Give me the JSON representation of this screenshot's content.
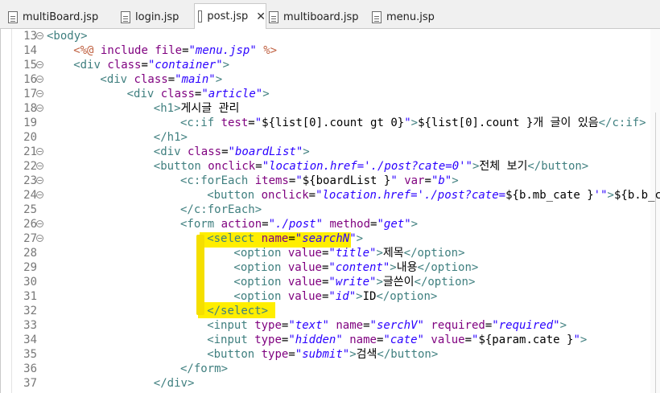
{
  "tabs": [
    {
      "label": "multiBoard.jsp",
      "active": false
    },
    {
      "label": "login.jsp",
      "active": false
    },
    {
      "label": "post.jsp",
      "active": true
    },
    {
      "label": "multiboard.jsp",
      "active": false
    },
    {
      "label": "menu.jsp",
      "active": false
    }
  ],
  "close_glyph": "✕",
  "fold_glyph": "−",
  "highlight_color": "#ffee00",
  "lines": [
    {
      "n": "13",
      "fold": true,
      "indent": 0,
      "parts": [
        [
          "t-tag",
          "<body>"
        ]
      ]
    },
    {
      "n": "14",
      "fold": false,
      "indent": 8,
      "parts": [
        [
          "t-dir",
          "<%@ "
        ],
        [
          "t-dirattr",
          "include "
        ],
        [
          "t-dirattr",
          "file"
        ],
        [
          "t-text",
          "="
        ],
        [
          "t-str",
          "\"menu.jsp\""
        ],
        [
          "t-dir",
          " %>"
        ]
      ]
    },
    {
      "n": "15",
      "fold": true,
      "indent": 8,
      "parts": [
        [
          "t-tag",
          "<div "
        ],
        [
          "t-attr",
          "class"
        ],
        [
          "t-text",
          "="
        ],
        [
          "t-str",
          "\"container\""
        ],
        [
          "t-tag",
          ">"
        ]
      ]
    },
    {
      "n": "16",
      "fold": true,
      "indent": 16,
      "parts": [
        [
          "t-tag",
          "<div "
        ],
        [
          "t-attr",
          "class"
        ],
        [
          "t-text",
          "="
        ],
        [
          "t-str",
          "\"main\""
        ],
        [
          "t-tag",
          ">"
        ]
      ]
    },
    {
      "n": "17",
      "fold": true,
      "indent": 24,
      "parts": [
        [
          "t-tag",
          "<div "
        ],
        [
          "t-attr",
          "class"
        ],
        [
          "t-text",
          "="
        ],
        [
          "t-str",
          "\"article\""
        ],
        [
          "t-tag",
          ">"
        ]
      ]
    },
    {
      "n": "18",
      "fold": true,
      "indent": 32,
      "parts": [
        [
          "t-tag",
          "<h1>"
        ],
        [
          "t-text",
          "게시글 관리"
        ]
      ]
    },
    {
      "n": "19",
      "fold": false,
      "indent": 40,
      "parts": [
        [
          "t-tag",
          "<c:if "
        ],
        [
          "t-attr",
          "test"
        ],
        [
          "t-text",
          "="
        ],
        [
          "t-str",
          "\""
        ],
        [
          "t-text",
          "${list[0].count gt 0}"
        ],
        [
          "t-str",
          "\""
        ],
        [
          "t-tag",
          ">"
        ],
        [
          "t-text",
          "${list[0].count }개 글이 있음"
        ],
        [
          "t-tag",
          "</c:if>"
        ]
      ]
    },
    {
      "n": "20",
      "fold": false,
      "indent": 32,
      "parts": [
        [
          "t-tag",
          "</h1>"
        ]
      ]
    },
    {
      "n": "21",
      "fold": true,
      "indent": 32,
      "parts": [
        [
          "t-tag",
          "<div "
        ],
        [
          "t-attr",
          "class"
        ],
        [
          "t-text",
          "="
        ],
        [
          "t-str",
          "\"boardList\""
        ],
        [
          "t-tag",
          ">"
        ]
      ]
    },
    {
      "n": "22",
      "fold": true,
      "indent": 32,
      "parts": [
        [
          "t-tag",
          "<button "
        ],
        [
          "t-attr",
          "onclick"
        ],
        [
          "t-text",
          "="
        ],
        [
          "t-str",
          "\"location.href='./post?cate=0'\""
        ],
        [
          "t-tag",
          ">"
        ],
        [
          "t-text",
          "전체 보기"
        ],
        [
          "t-tag",
          "</button>"
        ]
      ]
    },
    {
      "n": "23",
      "fold": true,
      "indent": 40,
      "parts": [
        [
          "t-tag",
          "<c:forEach "
        ],
        [
          "t-attr",
          "items"
        ],
        [
          "t-text",
          "="
        ],
        [
          "t-str",
          "\""
        ],
        [
          "t-text",
          "${boardList }"
        ],
        [
          "t-str",
          "\""
        ],
        [
          "t-text",
          " "
        ],
        [
          "t-attr",
          "var"
        ],
        [
          "t-text",
          "="
        ],
        [
          "t-str",
          "\"b\""
        ],
        [
          "t-tag",
          ">"
        ]
      ]
    },
    {
      "n": "24",
      "fold": true,
      "indent": 48,
      "parts": [
        [
          "t-tag",
          "<button "
        ],
        [
          "t-attr",
          "onclick"
        ],
        [
          "t-text",
          "="
        ],
        [
          "t-str",
          "\"location.href='./post?cate="
        ],
        [
          "t-text",
          "${b.mb_cate }"
        ],
        [
          "t-str",
          "'\""
        ],
        [
          "t-tag",
          ">"
        ],
        [
          "t-text",
          "${b.b_caten"
        ]
      ]
    },
    {
      "n": "25",
      "fold": false,
      "indent": 40,
      "parts": [
        [
          "t-tag",
          "</c:forEach>"
        ]
      ]
    },
    {
      "n": "26",
      "fold": true,
      "indent": 40,
      "parts": [
        [
          "t-tag",
          "<form "
        ],
        [
          "t-attr",
          "action"
        ],
        [
          "t-text",
          "="
        ],
        [
          "t-str",
          "\"./post\""
        ],
        [
          "t-text",
          " "
        ],
        [
          "t-attr",
          "method"
        ],
        [
          "t-text",
          "="
        ],
        [
          "t-str",
          "\"get\""
        ],
        [
          "t-tag",
          ">"
        ]
      ]
    },
    {
      "n": "27",
      "fold": true,
      "indent": 48,
      "parts": [
        [
          "t-tag",
          "<select "
        ],
        [
          "t-attr",
          "name"
        ],
        [
          "t-text",
          "="
        ],
        [
          "t-str",
          "\"searchN\""
        ],
        [
          "t-tag",
          ">"
        ]
      ]
    },
    {
      "n": "28",
      "fold": false,
      "indent": 56,
      "parts": [
        [
          "t-tag",
          "<option "
        ],
        [
          "t-attr",
          "value"
        ],
        [
          "t-text",
          "="
        ],
        [
          "t-str",
          "\"title\""
        ],
        [
          "t-tag",
          ">"
        ],
        [
          "t-text",
          "제목"
        ],
        [
          "t-tag",
          "</option>"
        ]
      ]
    },
    {
      "n": "29",
      "fold": false,
      "indent": 56,
      "parts": [
        [
          "t-tag",
          "<option "
        ],
        [
          "t-attr",
          "value"
        ],
        [
          "t-text",
          "="
        ],
        [
          "t-str",
          "\"content\""
        ],
        [
          "t-tag",
          ">"
        ],
        [
          "t-text",
          "내용"
        ],
        [
          "t-tag",
          "</option>"
        ]
      ]
    },
    {
      "n": "30",
      "fold": false,
      "indent": 56,
      "parts": [
        [
          "t-tag",
          "<option "
        ],
        [
          "t-attr",
          "value"
        ],
        [
          "t-text",
          "="
        ],
        [
          "t-str",
          "\"write\""
        ],
        [
          "t-tag",
          ">"
        ],
        [
          "t-text",
          "글쓴이"
        ],
        [
          "t-tag",
          "</option>"
        ]
      ]
    },
    {
      "n": "31",
      "fold": false,
      "indent": 56,
      "parts": [
        [
          "t-tag",
          "<option "
        ],
        [
          "t-attr",
          "value"
        ],
        [
          "t-text",
          "="
        ],
        [
          "t-str",
          "\"id\""
        ],
        [
          "t-tag",
          ">"
        ],
        [
          "t-text",
          "ID"
        ],
        [
          "t-tag",
          "</option>"
        ]
      ]
    },
    {
      "n": "32",
      "fold": false,
      "indent": 48,
      "parts": [
        [
          "t-tag",
          "</select>"
        ]
      ]
    },
    {
      "n": "33",
      "fold": false,
      "indent": 48,
      "parts": [
        [
          "t-tag",
          "<input "
        ],
        [
          "t-attr",
          "type"
        ],
        [
          "t-text",
          "="
        ],
        [
          "t-str",
          "\"text\""
        ],
        [
          "t-text",
          " "
        ],
        [
          "t-attr",
          "name"
        ],
        [
          "t-text",
          "="
        ],
        [
          "t-str",
          "\"serchV\""
        ],
        [
          "t-text",
          " "
        ],
        [
          "t-attr",
          "required"
        ],
        [
          "t-text",
          "="
        ],
        [
          "t-str",
          "\"required\""
        ],
        [
          "t-tag",
          ">"
        ]
      ]
    },
    {
      "n": "34",
      "fold": false,
      "indent": 48,
      "parts": [
        [
          "t-tag",
          "<input "
        ],
        [
          "t-attr",
          "type"
        ],
        [
          "t-text",
          "="
        ],
        [
          "t-str",
          "\"hidden\""
        ],
        [
          "t-text",
          " "
        ],
        [
          "t-attr",
          "name"
        ],
        [
          "t-text",
          "="
        ],
        [
          "t-str",
          "\"cate\""
        ],
        [
          "t-text",
          " "
        ],
        [
          "t-attr",
          "value"
        ],
        [
          "t-text",
          "="
        ],
        [
          "t-str",
          "\""
        ],
        [
          "t-text",
          "${param.cate }"
        ],
        [
          "t-str",
          "\""
        ],
        [
          "t-tag",
          ">"
        ]
      ]
    },
    {
      "n": "35",
      "fold": false,
      "indent": 48,
      "parts": [
        [
          "t-tag",
          "<button "
        ],
        [
          "t-attr",
          "type"
        ],
        [
          "t-text",
          "="
        ],
        [
          "t-str",
          "\"submit\""
        ],
        [
          "t-tag",
          ">"
        ],
        [
          "t-text",
          "검색"
        ],
        [
          "t-tag",
          "</button>"
        ]
      ]
    },
    {
      "n": "36",
      "fold": false,
      "indent": 40,
      "parts": [
        [
          "t-tag",
          "</form>"
        ]
      ]
    },
    {
      "n": "37",
      "fold": false,
      "indent": 32,
      "parts": [
        [
          "t-tag",
          "</div>"
        ]
      ]
    }
  ]
}
